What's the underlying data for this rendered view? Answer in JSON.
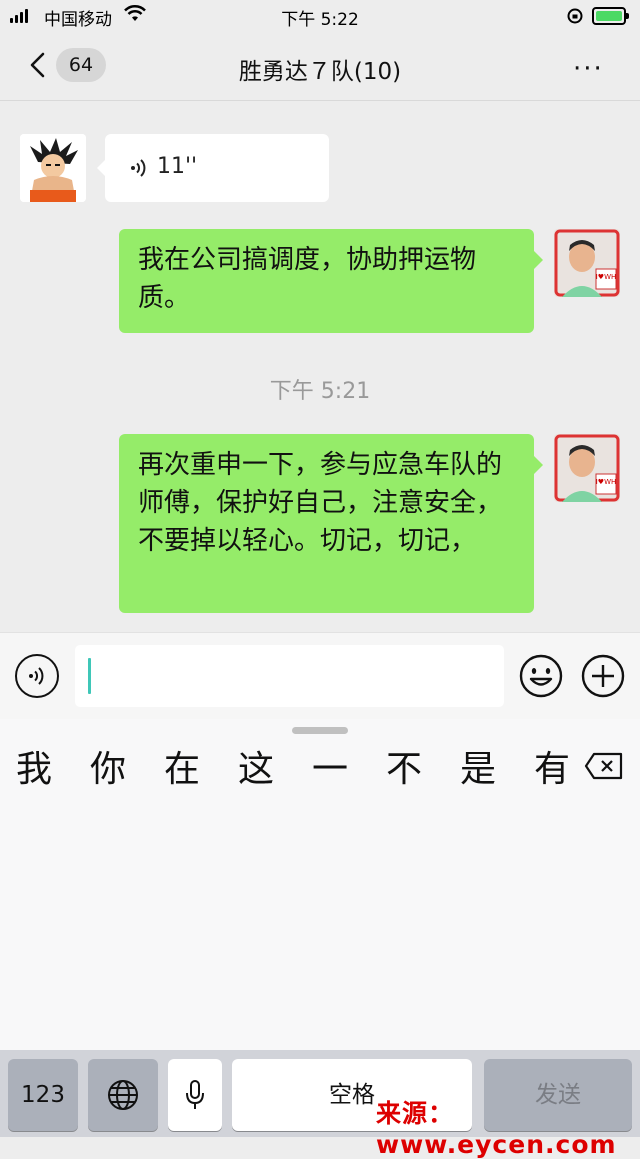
{
  "status_bar": {
    "carrier": "中国移动",
    "time": "下午 5:22"
  },
  "nav": {
    "back_count": "64",
    "title": "胜勇达７队(10)",
    "more": "···"
  },
  "messages": [
    {
      "side": "left",
      "type": "voice",
      "duration": "11''"
    },
    {
      "side": "right",
      "type": "text",
      "text": "我在公司搞调度，协助押运物质。"
    },
    {
      "type": "timestamp",
      "text": "下午 5:21"
    },
    {
      "side": "right",
      "type": "text",
      "text": "再次重申一下，参与应急车队的师傅，保护好自己，注意安全，不要掉以轻心。切记，切记，"
    }
  ],
  "avatar_badge": "I♥WH",
  "candidates": [
    "我",
    "你",
    "在",
    "这",
    "一",
    "不",
    "是",
    "有"
  ],
  "keyboard": {
    "numbers": "123",
    "space": "空格",
    "send": "发送"
  },
  "watermark": "来源：www.eycen.com",
  "icons": [
    "signal-icon",
    "wifi-icon",
    "rotation-lock-icon",
    "battery-icon",
    "back-chevron-icon",
    "more-icon",
    "voice-icon",
    "emoji-icon",
    "plus-icon",
    "delete-key-icon",
    "globe-icon",
    "microphone-icon"
  ],
  "colors": {
    "bubble_right": "#95ec69",
    "background": "#ededed",
    "watermark": "#dd0000"
  }
}
